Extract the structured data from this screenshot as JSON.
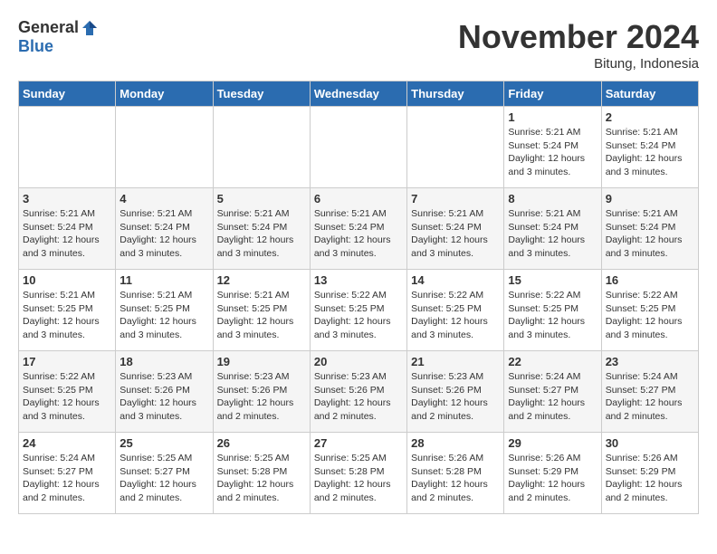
{
  "header": {
    "logo_general": "General",
    "logo_blue": "Blue",
    "month_title": "November 2024",
    "location": "Bitung, Indonesia"
  },
  "days_of_week": [
    "Sunday",
    "Monday",
    "Tuesday",
    "Wednesday",
    "Thursday",
    "Friday",
    "Saturday"
  ],
  "weeks": [
    [
      {
        "day": "",
        "info": ""
      },
      {
        "day": "",
        "info": ""
      },
      {
        "day": "",
        "info": ""
      },
      {
        "day": "",
        "info": ""
      },
      {
        "day": "",
        "info": ""
      },
      {
        "day": "1",
        "info": "Sunrise: 5:21 AM\nSunset: 5:24 PM\nDaylight: 12 hours and 3 minutes."
      },
      {
        "day": "2",
        "info": "Sunrise: 5:21 AM\nSunset: 5:24 PM\nDaylight: 12 hours and 3 minutes."
      }
    ],
    [
      {
        "day": "3",
        "info": "Sunrise: 5:21 AM\nSunset: 5:24 PM\nDaylight: 12 hours and 3 minutes."
      },
      {
        "day": "4",
        "info": "Sunrise: 5:21 AM\nSunset: 5:24 PM\nDaylight: 12 hours and 3 minutes."
      },
      {
        "day": "5",
        "info": "Sunrise: 5:21 AM\nSunset: 5:24 PM\nDaylight: 12 hours and 3 minutes."
      },
      {
        "day": "6",
        "info": "Sunrise: 5:21 AM\nSunset: 5:24 PM\nDaylight: 12 hours and 3 minutes."
      },
      {
        "day": "7",
        "info": "Sunrise: 5:21 AM\nSunset: 5:24 PM\nDaylight: 12 hours and 3 minutes."
      },
      {
        "day": "8",
        "info": "Sunrise: 5:21 AM\nSunset: 5:24 PM\nDaylight: 12 hours and 3 minutes."
      },
      {
        "day": "9",
        "info": "Sunrise: 5:21 AM\nSunset: 5:24 PM\nDaylight: 12 hours and 3 minutes."
      }
    ],
    [
      {
        "day": "10",
        "info": "Sunrise: 5:21 AM\nSunset: 5:25 PM\nDaylight: 12 hours and 3 minutes."
      },
      {
        "day": "11",
        "info": "Sunrise: 5:21 AM\nSunset: 5:25 PM\nDaylight: 12 hours and 3 minutes."
      },
      {
        "day": "12",
        "info": "Sunrise: 5:21 AM\nSunset: 5:25 PM\nDaylight: 12 hours and 3 minutes."
      },
      {
        "day": "13",
        "info": "Sunrise: 5:22 AM\nSunset: 5:25 PM\nDaylight: 12 hours and 3 minutes."
      },
      {
        "day": "14",
        "info": "Sunrise: 5:22 AM\nSunset: 5:25 PM\nDaylight: 12 hours and 3 minutes."
      },
      {
        "day": "15",
        "info": "Sunrise: 5:22 AM\nSunset: 5:25 PM\nDaylight: 12 hours and 3 minutes."
      },
      {
        "day": "16",
        "info": "Sunrise: 5:22 AM\nSunset: 5:25 PM\nDaylight: 12 hours and 3 minutes."
      }
    ],
    [
      {
        "day": "17",
        "info": "Sunrise: 5:22 AM\nSunset: 5:25 PM\nDaylight: 12 hours and 3 minutes."
      },
      {
        "day": "18",
        "info": "Sunrise: 5:23 AM\nSunset: 5:26 PM\nDaylight: 12 hours and 3 minutes."
      },
      {
        "day": "19",
        "info": "Sunrise: 5:23 AM\nSunset: 5:26 PM\nDaylight: 12 hours and 2 minutes."
      },
      {
        "day": "20",
        "info": "Sunrise: 5:23 AM\nSunset: 5:26 PM\nDaylight: 12 hours and 2 minutes."
      },
      {
        "day": "21",
        "info": "Sunrise: 5:23 AM\nSunset: 5:26 PM\nDaylight: 12 hours and 2 minutes."
      },
      {
        "day": "22",
        "info": "Sunrise: 5:24 AM\nSunset: 5:27 PM\nDaylight: 12 hours and 2 minutes."
      },
      {
        "day": "23",
        "info": "Sunrise: 5:24 AM\nSunset: 5:27 PM\nDaylight: 12 hours and 2 minutes."
      }
    ],
    [
      {
        "day": "24",
        "info": "Sunrise: 5:24 AM\nSunset: 5:27 PM\nDaylight: 12 hours and 2 minutes."
      },
      {
        "day": "25",
        "info": "Sunrise: 5:25 AM\nSunset: 5:27 PM\nDaylight: 12 hours and 2 minutes."
      },
      {
        "day": "26",
        "info": "Sunrise: 5:25 AM\nSunset: 5:28 PM\nDaylight: 12 hours and 2 minutes."
      },
      {
        "day": "27",
        "info": "Sunrise: 5:25 AM\nSunset: 5:28 PM\nDaylight: 12 hours and 2 minutes."
      },
      {
        "day": "28",
        "info": "Sunrise: 5:26 AM\nSunset: 5:28 PM\nDaylight: 12 hours and 2 minutes."
      },
      {
        "day": "29",
        "info": "Sunrise: 5:26 AM\nSunset: 5:29 PM\nDaylight: 12 hours and 2 minutes."
      },
      {
        "day": "30",
        "info": "Sunrise: 5:26 AM\nSunset: 5:29 PM\nDaylight: 12 hours and 2 minutes."
      }
    ]
  ]
}
